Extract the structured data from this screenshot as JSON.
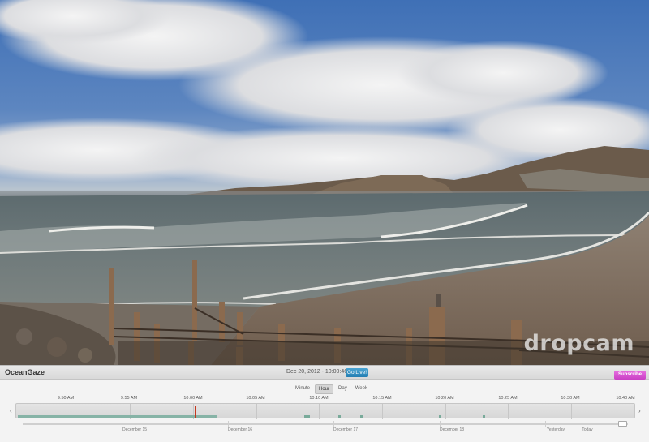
{
  "camera": {
    "watermark": "dropcam"
  },
  "infobar": {
    "camera_name": "OceanGaze",
    "datetime": "Dec 20, 2012 - 10:00:46 AM",
    "go_live_label": "Go Live!",
    "subscribe_label": "Subscribe"
  },
  "timeline": {
    "zoom_options": [
      "Minute",
      "Hour",
      "Day",
      "Week"
    ],
    "zoom_selected": "Hour",
    "time_labels": [
      "9:50 AM",
      "9:55 AM",
      "10:00 AM",
      "10:05 AM",
      "10:10 AM",
      "10:15 AM",
      "10:20 AM",
      "10:25 AM",
      "10:30 AM",
      "10:40 AM"
    ],
    "day_labels": [
      "December 15",
      "December 16",
      "December 17",
      "December 18",
      "Yesterday",
      "Today"
    ],
    "recording_color": "#86b3a6",
    "playhead_color": "#c4381f"
  },
  "icons": {
    "prev": "chevron-left-icon",
    "next": "chevron-right-icon"
  }
}
